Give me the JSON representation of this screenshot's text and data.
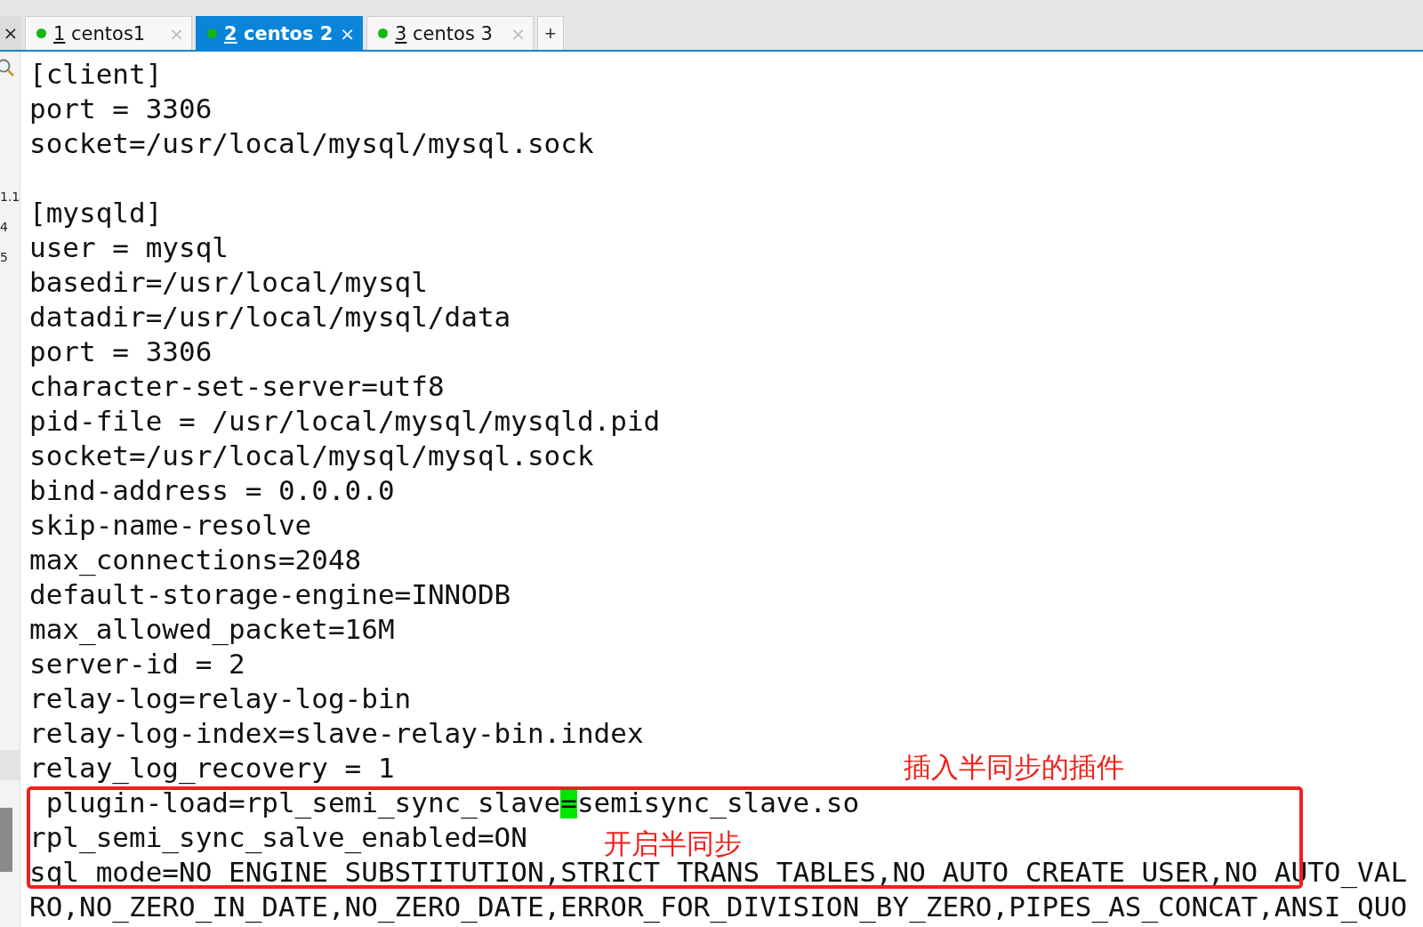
{
  "tab_bar": {
    "close_glyph": "×",
    "add_button": "+",
    "tabs": [
      {
        "number": "1",
        "title": "centos1",
        "selected": false,
        "color": "#12b812",
        "close": "×"
      },
      {
        "number": "2",
        "title": "centos 2",
        "selected": true,
        "color": "#12b812",
        "close": "×"
      },
      {
        "number": "3",
        "title": "centos 3",
        "selected": false,
        "color": "#12b812",
        "close": "×"
      }
    ]
  },
  "gutter": {
    "labels": [
      "1.1",
      "4",
      "5"
    ]
  },
  "editor": {
    "lines": [
      {
        "kind": "code",
        "text": "[client]"
      },
      {
        "kind": "code",
        "text": "port = 3306"
      },
      {
        "kind": "code",
        "text": "socket=/usr/local/mysql/mysql.sock"
      },
      {
        "kind": "blank"
      },
      {
        "kind": "code",
        "text": "[mysqld]"
      },
      {
        "kind": "code",
        "text": "user = mysql"
      },
      {
        "kind": "code",
        "text": "basedir=/usr/local/mysql"
      },
      {
        "kind": "code",
        "text": "datadir=/usr/local/mysql/data"
      },
      {
        "kind": "code",
        "text": "port = 3306"
      },
      {
        "kind": "code",
        "text": "character-set-server=utf8"
      },
      {
        "kind": "code",
        "text": "pid-file = /usr/local/mysql/mysqld.pid"
      },
      {
        "kind": "code",
        "text": "socket=/usr/local/mysql/mysql.sock"
      },
      {
        "kind": "code",
        "text": "bind-address = 0.0.0.0"
      },
      {
        "kind": "code",
        "text": "skip-name-resolve"
      },
      {
        "kind": "code",
        "text": "max_connections=2048"
      },
      {
        "kind": "code",
        "text": "default-storage-engine=INNODB"
      },
      {
        "kind": "code",
        "text": "max_allowed_packet=16M"
      },
      {
        "kind": "code",
        "text": "server-id = 2"
      },
      {
        "kind": "code",
        "text": "relay-log=relay-log-bin"
      },
      {
        "kind": "code",
        "text": "relay-log-index=slave-relay-bin.index"
      },
      {
        "kind": "code",
        "text": "relay_log_recovery = 1"
      },
      {
        "kind": "code",
        "text": " plugin-load=rpl_semi_sync_slave",
        "cursor": "=",
        "after": "semisync_slave.so"
      },
      {
        "kind": "code",
        "text": "rpl_semi_sync_salve_enabled=ON"
      },
      {
        "kind": "code",
        "text": "sql mode=NO ENGINE SUBSTITUTION,STRICT TRANS TABLES,NO AUTO CREATE USER,NO AUTO_VAL"
      },
      {
        "kind": "code",
        "text": "RO,NO_ZERO_IN_DATE,NO_ZERO_DATE,ERROR_FOR_DIVISION_BY_ZERO,PIPES_AS_CONCAT,ANSI_QUO"
      }
    ],
    "annotations": [
      {
        "text": "插入半同步的插件",
        "kind": "upper"
      },
      {
        "text": "开启半同步",
        "kind": "lower"
      }
    ]
  }
}
